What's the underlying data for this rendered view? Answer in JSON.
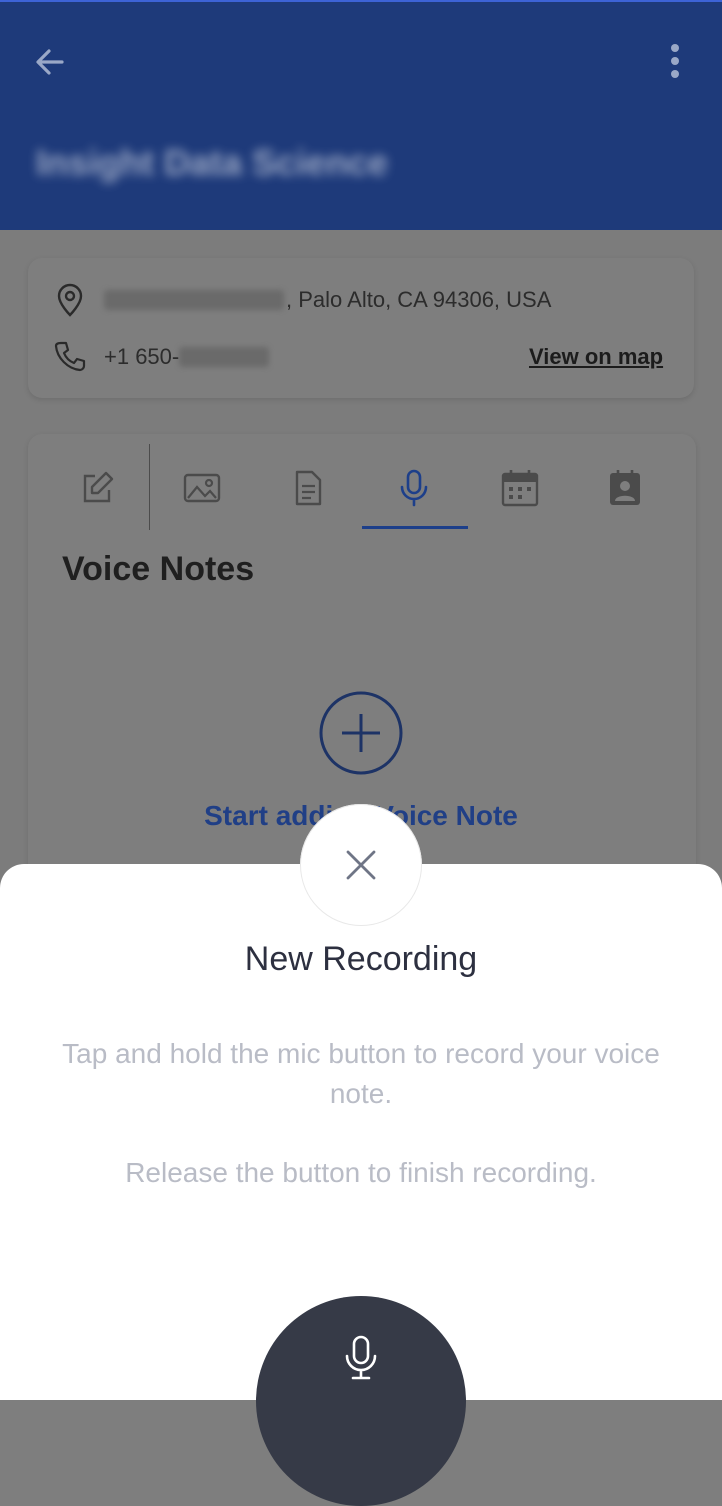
{
  "appbar": {
    "title": "Insight Data Science",
    "back_icon": "arrow-left-icon",
    "menu_icon": "more-vertical-icon"
  },
  "contact": {
    "address_visible": ", Palo Alto, CA 94306, USA",
    "phone_prefix": "+1 650-",
    "view_map_label": "View on map"
  },
  "tabs": [
    {
      "icon": "edit-icon",
      "active": false
    },
    {
      "icon": "image-icon",
      "active": false
    },
    {
      "icon": "document-icon",
      "active": false
    },
    {
      "icon": "microphone-icon",
      "active": true
    },
    {
      "icon": "calendar-icon",
      "active": false
    },
    {
      "icon": "contact-badge-icon",
      "active": false
    }
  ],
  "section": {
    "title": "Voice Notes",
    "add_label": "Start adding Voice Note"
  },
  "sheet": {
    "title": "New Recording",
    "instruction_1": "Tap and hold the mic button to record your voice note.",
    "instruction_2": "Release the button to finish recording."
  },
  "colors": {
    "appbar": "#1e3a7a",
    "accent": "#203f86",
    "mic_button": "#363a47"
  }
}
